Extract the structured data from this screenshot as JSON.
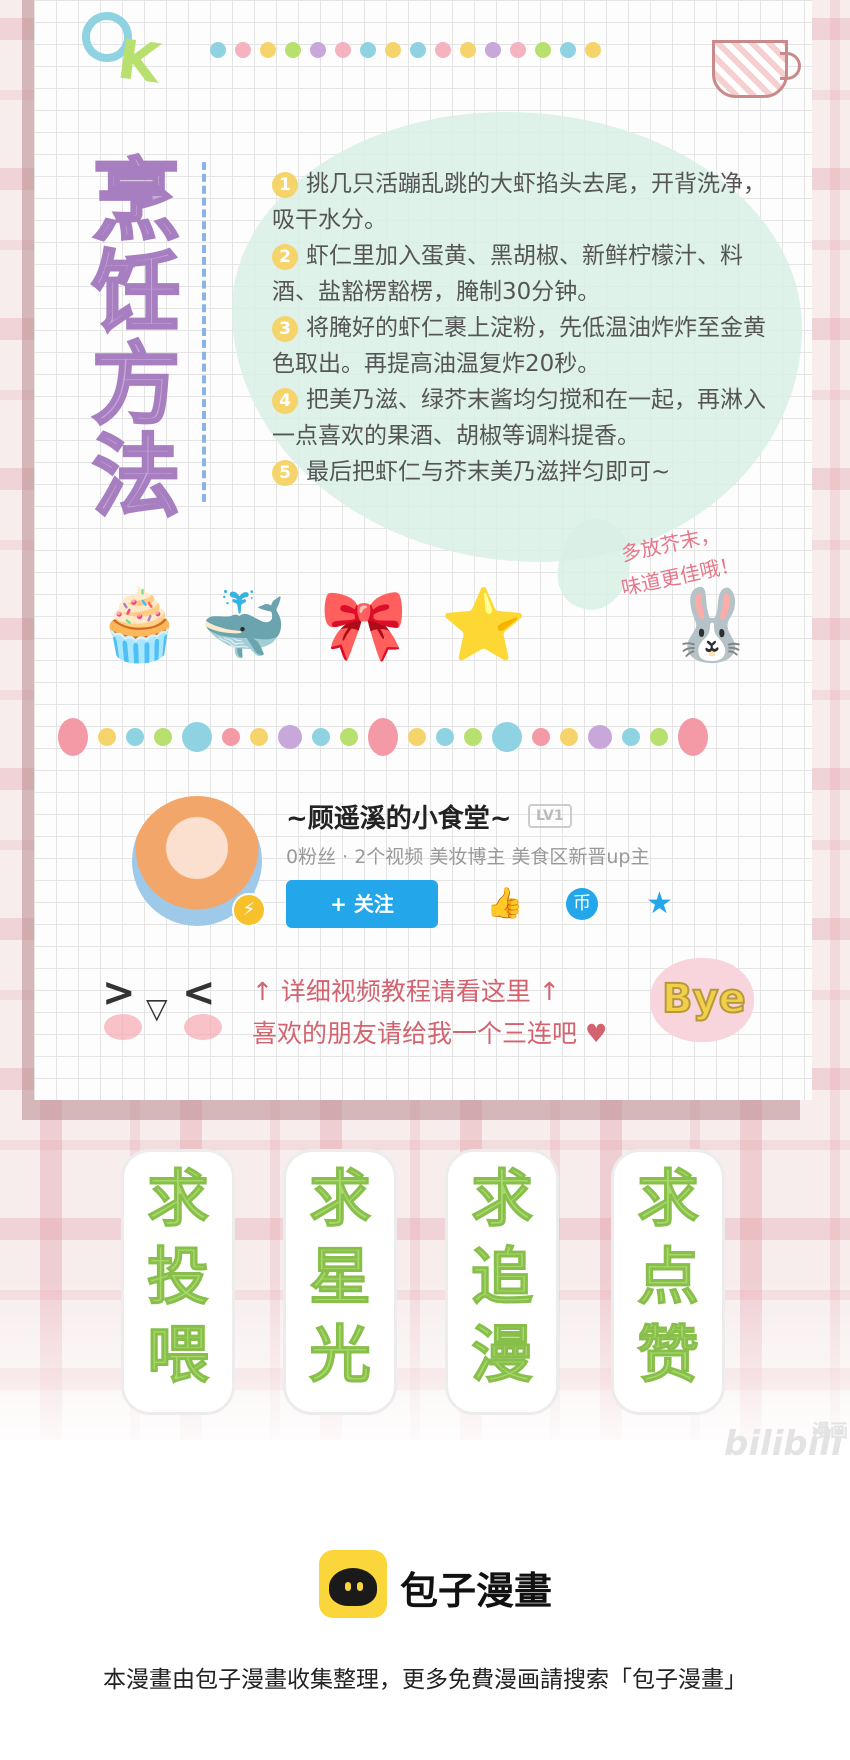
{
  "title": "烹饪方法",
  "title_chars": [
    "烹",
    "饪",
    "方",
    "法"
  ],
  "steps": [
    {
      "num": "1",
      "text": "挑几只活蹦乱跳的大虾掐头去尾，开背洗净，吸干水分。"
    },
    {
      "num": "2",
      "text": "虾仁里加入蛋黄、黑胡椒、新鲜柠檬汁、料酒、盐豁楞豁楞，腌制30分钟。"
    },
    {
      "num": "3",
      "text": "将腌好的虾仁裹上淀粉，先低温油炸炸至金黄色取出。再提高油温复炸20秒。"
    },
    {
      "num": "4",
      "text": "把美乃滋、绿芥末酱均匀搅和在一起，再淋入一点喜欢的果酒、胡椒等调料提香。"
    },
    {
      "num": "5",
      "text": "最后把虾仁与芥末美乃滋拌匀即可~"
    }
  ],
  "note": {
    "line1": "多放芥末，",
    "line2": "味道更佳哦！"
  },
  "profile": {
    "name": "~顾遥溪的小食堂~",
    "level": "LV1",
    "meta": "0粉丝 · 2个视频   美妆博主 美食区新晋up主",
    "follow_label": "+ 关注",
    "actions": [
      {
        "icon": "thumbs-up-icon",
        "glyph": "👍"
      },
      {
        "icon": "coin-icon",
        "glyph": "币"
      },
      {
        "icon": "star-icon",
        "glyph": "★"
      }
    ]
  },
  "cta": {
    "line1": "↑ 详细视频教程请看这里 ↑",
    "line2": "喜欢的朋友请给我一个三连吧 ♥"
  },
  "bye": "Bye",
  "cards": [
    {
      "text": "求投喂"
    },
    {
      "text": "求星光"
    },
    {
      "text": "求追漫"
    },
    {
      "text": "求点赞"
    }
  ],
  "watermark": {
    "brand": "bilibili",
    "suffix": "漫画"
  },
  "footer": {
    "logo_name": "包子漫畫",
    "description": "本漫畫由包子漫畫收集整理，更多免費漫画請搜索「包子漫畫」"
  },
  "colors": {
    "accent_blue": "#23a6ea",
    "title_purple": "#c8a7da",
    "card_green": "#a6d86a",
    "cta_red": "#d2636f",
    "logo_yellow": "#fbd63b"
  }
}
